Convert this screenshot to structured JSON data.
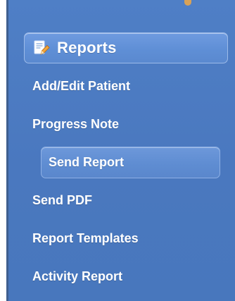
{
  "menu": {
    "header": {
      "label": "Reports",
      "icon": "report-edit-icon"
    },
    "items": [
      {
        "label": "Add/Edit Patient",
        "active": false
      },
      {
        "label": "Progress Note",
        "active": false
      },
      {
        "label": "Send Report",
        "active": true
      },
      {
        "label": "Send PDF",
        "active": false
      },
      {
        "label": "Report Templates",
        "active": false
      },
      {
        "label": "Activity Report",
        "active": false
      }
    ]
  },
  "colors": {
    "background": "#4a78bf",
    "header_background": "#6f9be0",
    "active_item_background": "#6d98da",
    "text": "#ffffff",
    "accent": "#e8a64a"
  }
}
